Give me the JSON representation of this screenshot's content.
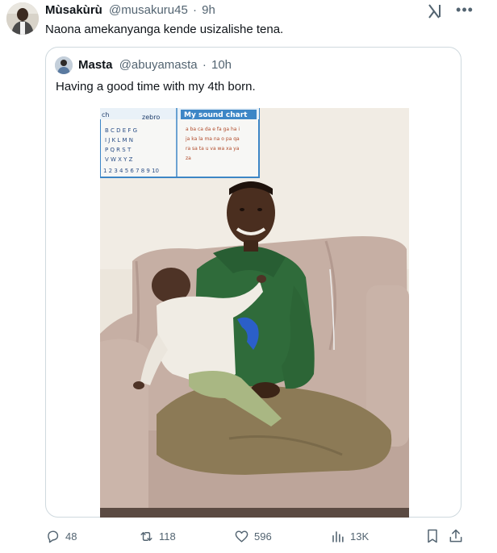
{
  "tweet": {
    "author_name": "Mùsakùrù",
    "author_handle": "@musakuru45",
    "separator": "·",
    "time": "9h",
    "text": "Naona amekanyanga kende usizalishe tena."
  },
  "quote": {
    "author_name": "Masta",
    "author_handle": "@abuyamasta",
    "separator": "·",
    "time": "10h",
    "text": "Having a good time with my 4th born.",
    "photo": {
      "poster_title": "My sound chart",
      "poster_tab_left": "ch",
      "poster_tab_zebra": "zebro",
      "poster_letters_row1": "B C D E F G",
      "poster_letters_row2": "I J K L M N",
      "poster_letters_row3": "P Q R S T",
      "poster_letters_row4": "V W X Y Z",
      "poster_numbers": "1 2 3 4 5 6 7 8 9 10",
      "poster_sounds_row1": "a ba ca da e fa ga ha i",
      "poster_sounds_row2": "ja ka la ma na o pa qa",
      "poster_sounds_row3": "ra sa ta u va wa xa ya",
      "poster_sounds_row4": "za"
    }
  },
  "actions": {
    "replies": "48",
    "reposts": "118",
    "likes": "596",
    "views": "13K"
  },
  "icons": [
    "grok-icon",
    "more-icon",
    "reply-icon",
    "repost-icon",
    "like-icon",
    "views-icon",
    "bookmark-icon",
    "share-icon"
  ],
  "colors": {
    "text": "#0f1419",
    "secondary": "#536471",
    "border": "#cfd9de"
  }
}
